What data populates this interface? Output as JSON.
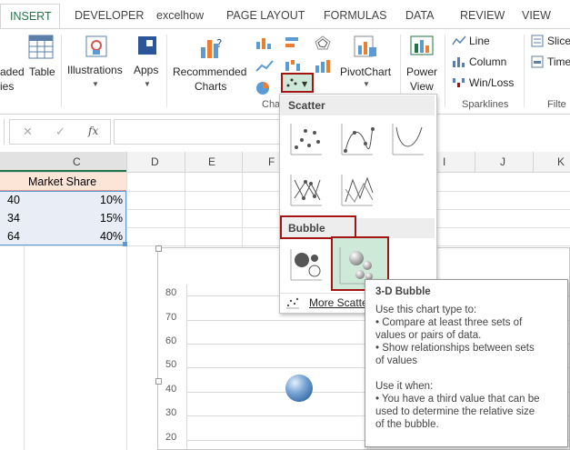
{
  "tabs": [
    "INSERT",
    "DEVELOPER",
    "excelhow",
    "PAGE LAYOUT",
    "FORMULAS",
    "DATA",
    "REVIEW",
    "VIEW"
  ],
  "ribbon": {
    "partial_left_1": "aded",
    "partial_left_2": "ies",
    "table": "Table",
    "illustrations": "Illustrations",
    "apps": "Apps",
    "recommended_charts_1": "Recommended",
    "recommended_charts_2": "Charts",
    "pivotchart": "PivotChart",
    "power_view_1": "Power",
    "power_view_2": "View",
    "line": "Line",
    "column": "Column",
    "winloss": "Win/Loss",
    "slicer": "Slice",
    "timeline": "Time",
    "group_charts": "Cha",
    "group_sparklines": "Sparklines",
    "group_filters": "Filte"
  },
  "formula_bar": {
    "cancel": "✕",
    "enter": "✓",
    "fx": "fx"
  },
  "columns": [
    "C",
    "D",
    "E",
    "F",
    "I",
    "J",
    "K"
  ],
  "table": {
    "header": "Market Share",
    "rows": [
      {
        "b": "40",
        "c": "10%"
      },
      {
        "b": "34",
        "c": "15%"
      },
      {
        "b": "64",
        "c": "40%"
      }
    ]
  },
  "chart": {
    "y_ticks": [
      "80",
      "70",
      "60",
      "50",
      "40",
      "30",
      "20"
    ]
  },
  "menu": {
    "scatter_header": "Scatter",
    "bubble_header": "Bubble",
    "more": "More Scatte"
  },
  "tooltip": {
    "title": "3-D Bubble",
    "lines": [
      "Use this chart type to:",
      "• Compare at least three sets of",
      "values or pairs of data.",
      "• Show relationships between sets",
      "of values",
      "",
      "Use it when:",
      "• You have a third value that can be",
      "used to determine the relative size",
      "of the bubble."
    ]
  },
  "colors": {
    "accent": "#217346",
    "highlight": "#a31515",
    "selected_bg": "#cfe9d9",
    "table_border": "#5b9bd5"
  }
}
